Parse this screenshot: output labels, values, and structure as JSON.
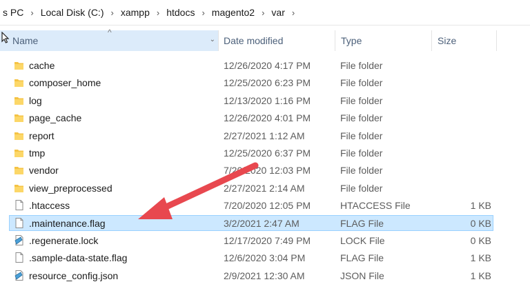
{
  "breadcrumb": [
    "s PC",
    "Local Disk (C:)",
    "xampp",
    "htdocs",
    "magento2",
    "var"
  ],
  "breadcrumb_separator": "›",
  "columns": {
    "name": "Name",
    "date": "Date modified",
    "type": "Type",
    "size": "Size"
  },
  "sort_indicator": "^",
  "column_chevron": "⌄",
  "files": [
    {
      "name": "cache",
      "date": "12/26/2020 4:17 PM",
      "type": "File folder",
      "size": "",
      "icon": "folder-icon"
    },
    {
      "name": "composer_home",
      "date": "12/25/2020 6:23 PM",
      "type": "File folder",
      "size": "",
      "icon": "folder-icon"
    },
    {
      "name": "log",
      "date": "12/13/2020 1:16 PM",
      "type": "File folder",
      "size": "",
      "icon": "folder-icon"
    },
    {
      "name": "page_cache",
      "date": "12/26/2020 4:01 PM",
      "type": "File folder",
      "size": "",
      "icon": "folder-icon"
    },
    {
      "name": "report",
      "date": "2/27/2021 1:12 AM",
      "type": "File folder",
      "size": "",
      "icon": "folder-icon"
    },
    {
      "name": "tmp",
      "date": "12/25/2020 6:37 PM",
      "type": "File folder",
      "size": "",
      "icon": "folder-icon"
    },
    {
      "name": "vendor",
      "date": "7/20/2020 12:03 PM",
      "type": "File folder",
      "size": "",
      "icon": "folder-icon"
    },
    {
      "name": "view_preprocessed",
      "date": "2/27/2021 2:14 AM",
      "type": "File folder",
      "size": "",
      "icon": "folder-icon"
    },
    {
      "name": ".htaccess",
      "date": "7/20/2020 12:05 PM",
      "type": "HTACCESS File",
      "size": "1 KB",
      "icon": "file-icon"
    },
    {
      "name": ".maintenance.flag",
      "date": "3/2/2021 2:47 AM",
      "type": "FLAG File",
      "size": "0 KB",
      "icon": "file-icon",
      "selected": true
    },
    {
      "name": ".regenerate.lock",
      "date": "12/17/2020 7:49 PM",
      "type": "LOCK File",
      "size": "0 KB",
      "icon": "special-file-icon"
    },
    {
      "name": ".sample-data-state.flag",
      "date": "12/6/2020 3:04 PM",
      "type": "FLAG File",
      "size": "1 KB",
      "icon": "file-icon"
    },
    {
      "name": "resource_config.json",
      "date": "2/9/2021 12:30 AM",
      "type": "JSON File",
      "size": "1 KB",
      "icon": "special-file-icon"
    }
  ],
  "colors": {
    "selection_bg": "#cce8ff",
    "selection_border": "#99d1ff",
    "header_highlight": "#dcebfa",
    "folder": "#f5c344",
    "annotation_arrow": "#e8484f"
  }
}
